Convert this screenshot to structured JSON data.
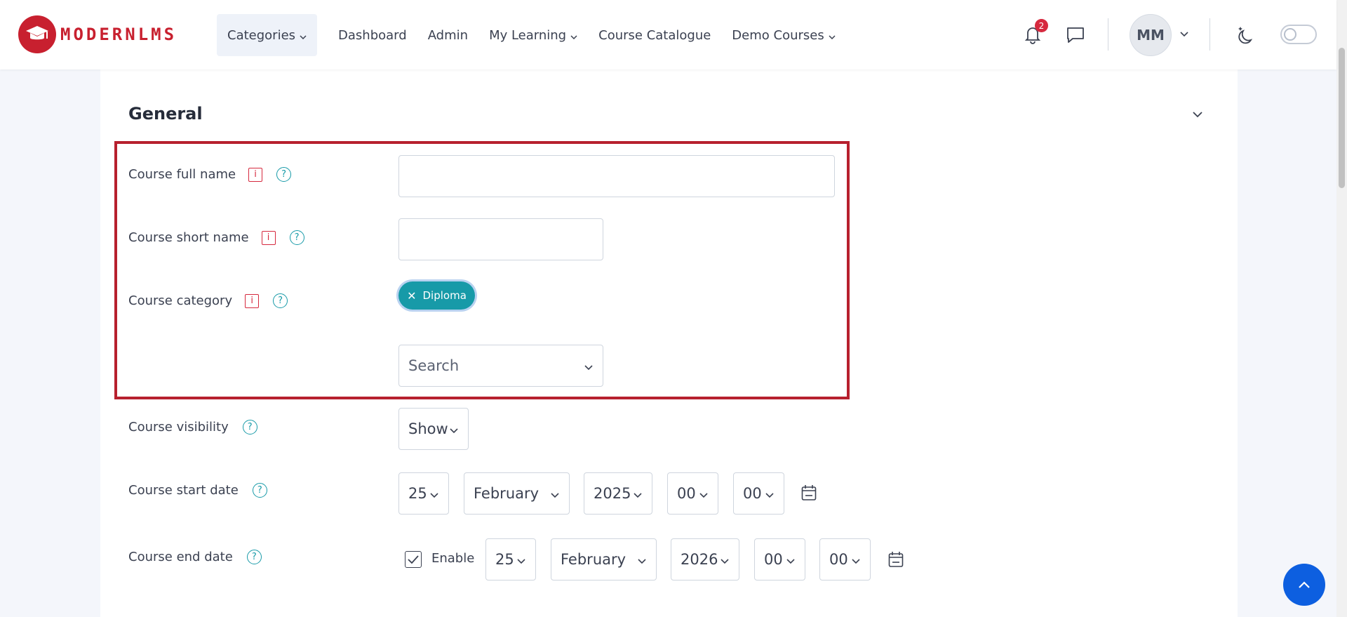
{
  "brand": {
    "name": "MODERNLMS",
    "color": "#c8202f"
  },
  "nav": {
    "items": [
      {
        "label": "Categories",
        "dropdown": true,
        "active": true
      },
      {
        "label": "Dashboard",
        "dropdown": false
      },
      {
        "label": "Admin",
        "dropdown": false
      },
      {
        "label": "My Learning",
        "dropdown": true
      },
      {
        "label": "Course Catalogue",
        "dropdown": false
      },
      {
        "label": "Demo Courses",
        "dropdown": true
      }
    ],
    "notifications_count": "2",
    "user_initials": "MM"
  },
  "section": {
    "title": "General"
  },
  "form": {
    "full_name": {
      "label": "Course full name",
      "value": ""
    },
    "short_name": {
      "label": "Course short name",
      "value": ""
    },
    "category": {
      "label": "Course category",
      "selected_chip": "Diploma",
      "search_placeholder": "Search"
    },
    "visibility": {
      "label": "Course visibility",
      "value": "Show"
    },
    "start_date": {
      "label": "Course start date",
      "day": "25",
      "month": "February",
      "year": "2025",
      "hour": "00",
      "minute": "00"
    },
    "end_date": {
      "label": "Course end date",
      "enable_label": "Enable",
      "enabled": true,
      "day": "25",
      "month": "February",
      "year": "2026",
      "hour": "00",
      "minute": "00"
    }
  },
  "icons": {
    "info": "exclamation-info-icon",
    "help": "question-circle-icon",
    "bell": "bell-icon",
    "chat": "chat-bubble-icon",
    "theme": "moon-stars-icon",
    "calendar": "calendar-icon",
    "back_to_top": "chevron-up-icon"
  },
  "colors": {
    "accent": "#179aa8",
    "error": "#d6293e",
    "fab": "#0d5fe0",
    "highlight": "#b7202e"
  }
}
